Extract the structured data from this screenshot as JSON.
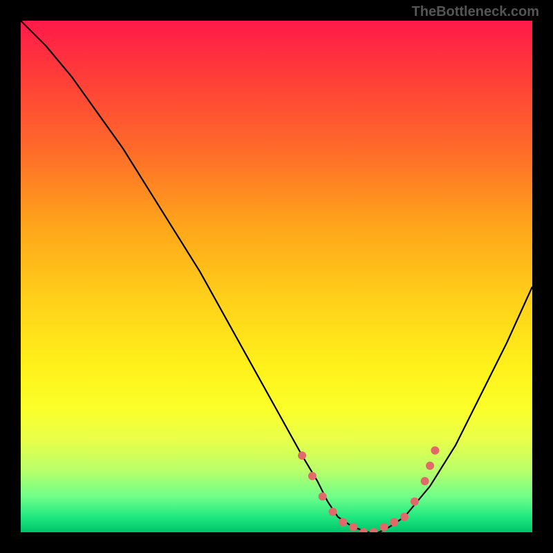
{
  "watermark": "TheBottleneck.com",
  "chart_data": {
    "type": "line",
    "title": "",
    "xlabel": "",
    "ylabel": "",
    "xlim": [
      0,
      100
    ],
    "ylim": [
      0,
      100
    ],
    "series": [
      {
        "name": "bottleneck-curve",
        "x": [
          0,
          5,
          10,
          15,
          20,
          25,
          30,
          35,
          40,
          45,
          50,
          55,
          58,
          60,
          62,
          65,
          68,
          70,
          72,
          75,
          80,
          85,
          90,
          95,
          100
        ],
        "y": [
          100,
          95,
          89,
          82,
          75,
          67,
          59,
          51,
          42,
          33,
          24,
          15,
          10,
          6,
          3,
          1,
          0,
          0,
          1,
          3,
          9,
          17,
          27,
          37,
          48
        ]
      }
    ],
    "markers": {
      "name": "highlight-dots",
      "color": "#e06a6a",
      "x": [
        55,
        57,
        59,
        61,
        63,
        65,
        67,
        69,
        71,
        73,
        75,
        77,
        79,
        80,
        81
      ],
      "y": [
        15,
        11,
        7,
        4,
        2,
        1,
        0,
        0,
        1,
        2,
        3,
        6,
        10,
        13,
        16
      ]
    }
  }
}
